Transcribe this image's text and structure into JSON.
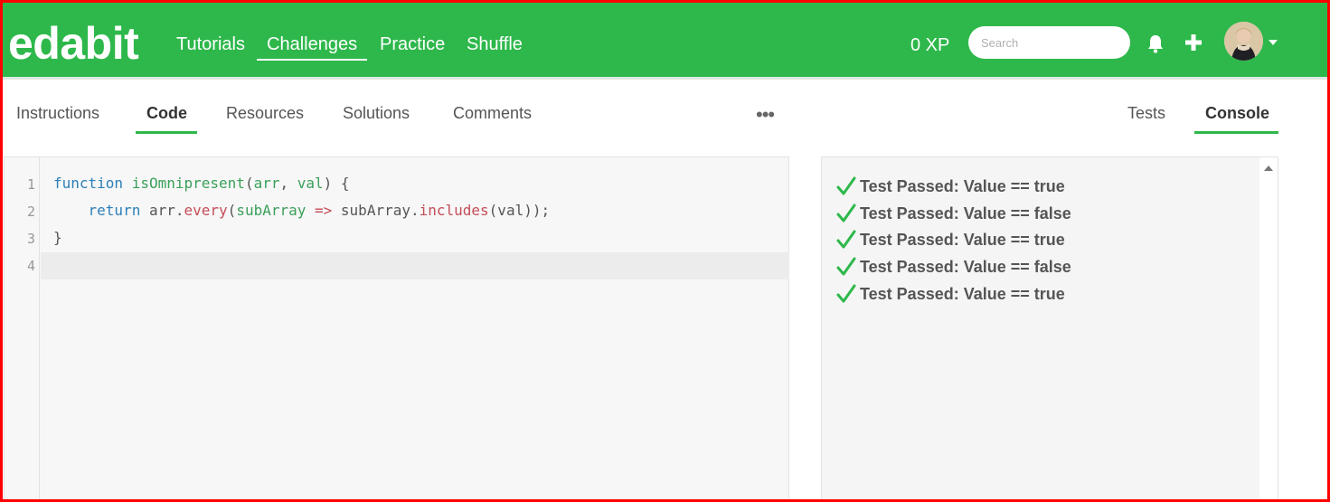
{
  "header": {
    "logo": "edabit",
    "nav": [
      "Tutorials",
      "Challenges",
      "Practice",
      "Shuffle"
    ],
    "active_nav": "Challenges",
    "xp": "0 XP",
    "search_placeholder": "Search",
    "icons": [
      "bell-icon",
      "plus-icon",
      "avatar",
      "caret-down-icon"
    ]
  },
  "tabs": {
    "left": [
      "Instructions",
      "Code",
      "Resources",
      "Solutions",
      "Comments"
    ],
    "active_left": "Code",
    "more": "•••",
    "right": [
      "Tests",
      "Console"
    ],
    "active_right": "Console"
  },
  "editor": {
    "line_numbers": [
      "1",
      "2",
      "3",
      "4"
    ],
    "code": [
      "function isOmnipresent(arr, val) {",
      "    return arr.every(subArray => subArray.includes(val));",
      "}",
      ""
    ],
    "tokens": {
      "l1_kw": "function",
      "l1_fn": "isOmnipresent",
      "l1_open": "(",
      "l1_p1": "arr",
      "l1_comma": ", ",
      "l1_p2": "val",
      "l1_close": ") {",
      "l2_indent": "    ",
      "l2_kw": "return",
      "l2_obj": " arr.",
      "l2_m1": "every",
      "l2_open": "(",
      "l2_param": "subArray",
      "l2_sp": " ",
      "l2_arrow": "=>",
      "l2_obj2": " subArray.",
      "l2_m2": "includes",
      "l2_end": "(val));",
      "l3": "}"
    }
  },
  "console": {
    "results": [
      "Test Passed: Value == true",
      "Test Passed: Value == false",
      "Test Passed: Value == true",
      "Test Passed: Value == false",
      "Test Passed: Value == true"
    ],
    "check_color": "#2eb84b"
  },
  "colors": {
    "brand": "#2eb84b",
    "frame": "#ff0000"
  }
}
